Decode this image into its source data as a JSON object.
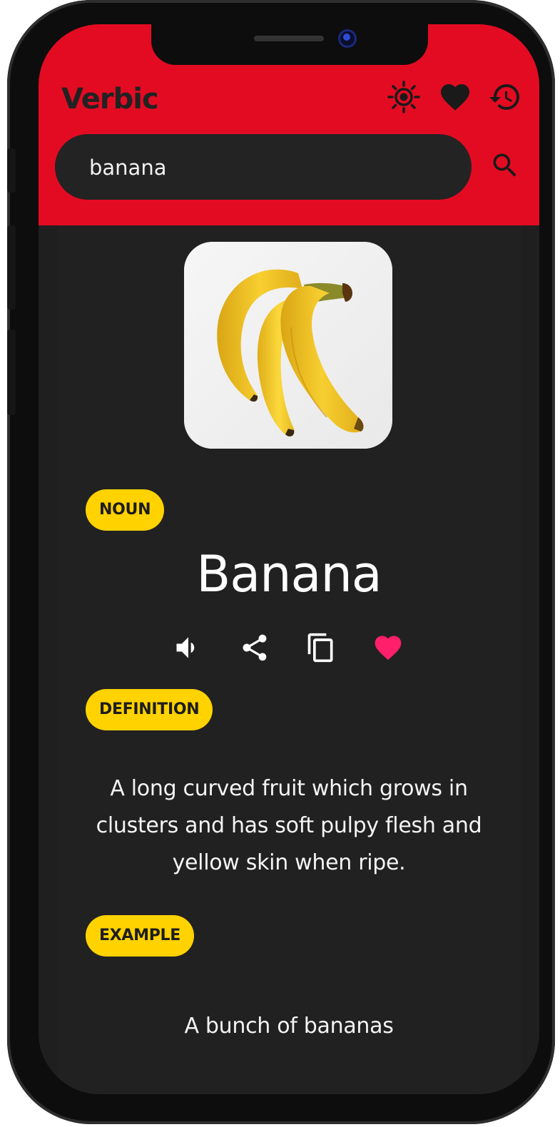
{
  "app": {
    "title": "Verbic"
  },
  "header_icons": [
    {
      "name": "theme-icon"
    },
    {
      "name": "favorites-icon"
    },
    {
      "name": "history-icon"
    }
  ],
  "search": {
    "value": "banana",
    "icon": "search-icon"
  },
  "entry": {
    "image_subject": "banana-bunch",
    "part_of_speech": "NOUN",
    "word": "Banana",
    "actions": [
      "speaker-icon",
      "share-icon",
      "copy-icon",
      "heart-icon"
    ],
    "definition_label": "DEFINITION",
    "definition": "A long curved fruit which grows in clusters and has soft pulpy flesh and yellow skin when ripe.",
    "example_label": "EXAMPLE",
    "example": "A bunch of bananas"
  },
  "colors": {
    "header": "#e30b22",
    "background": "#212121",
    "pill": "#ffd200",
    "favorite": "#ff1f6b",
    "text": "#ffffff"
  }
}
